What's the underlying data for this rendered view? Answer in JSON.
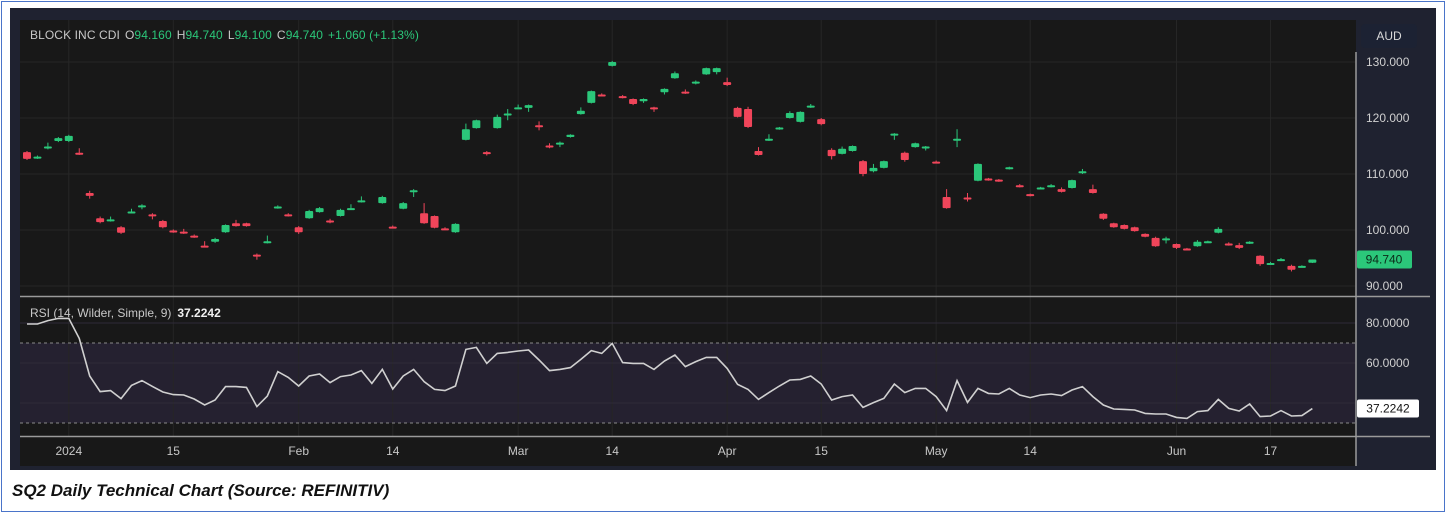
{
  "header": {
    "symbol": "BLOCK INC CDI",
    "open_label": "O",
    "open": "94.160",
    "high_label": "H",
    "high": "94.740",
    "low_label": "L",
    "low": "94.100",
    "close_label": "C",
    "close": "94.740",
    "change": "+1.060 (+1.13%)"
  },
  "currency_button": "AUD",
  "rsi_legend": {
    "label": "RSI (14, Wilder, Simple, 9)",
    "value": "37.2242"
  },
  "caption": "SQ2 Daily Technical Chart (Source: REFINITIV)",
  "colors": {
    "up": "#2bc77a",
    "down": "#f0455a",
    "rsi_line": "#d0d0d0",
    "background": "#181818",
    "rsi_band": "#252130"
  },
  "chart_data": [
    {
      "type": "candlestick",
      "title": "",
      "price_axis": {
        "range": [
          88,
          132
        ],
        "ticks": [
          90,
          100,
          110,
          120,
          130
        ],
        "tick_labels": [
          "90.000",
          "100.000",
          "110.000",
          "120.000",
          "130.000"
        ]
      },
      "last_price_label": "94.740",
      "x_ticks": [
        {
          "label": "2024",
          "at": 4
        },
        {
          "label": "15",
          "at": 14
        },
        {
          "label": "Feb",
          "at": 26
        },
        {
          "label": "14",
          "at": 35
        },
        {
          "label": "Mar",
          "at": 47
        },
        {
          "label": "14",
          "at": 56
        },
        {
          "label": "Apr",
          "at": 67
        },
        {
          "label": "15",
          "at": 76
        },
        {
          "label": "May",
          "at": 87
        },
        {
          "label": "14",
          "at": 96
        },
        {
          "label": "Jun",
          "at": 110
        },
        {
          "label": "17",
          "at": 119
        }
      ],
      "ohlc": [
        [
          113.9,
          114.1,
          112.5,
          112.7
        ],
        [
          112.9,
          113.3,
          112.7,
          113.1
        ],
        [
          114.6,
          115.6,
          114.4,
          114.9
        ],
        [
          115.9,
          116.6,
          115.7,
          116.4
        ],
        [
          115.9,
          117.0,
          115.7,
          116.8
        ],
        [
          113.8,
          114.6,
          113.4,
          113.6
        ],
        [
          106.6,
          107.0,
          105.6,
          106.1
        ],
        [
          102.1,
          102.4,
          101.2,
          101.4
        ],
        [
          101.7,
          102.4,
          101.5,
          101.9
        ],
        [
          100.5,
          100.7,
          99.3,
          99.5
        ],
        [
          103.1,
          103.8,
          103.0,
          103.3
        ],
        [
          104.2,
          104.6,
          103.7,
          104.4
        ],
        [
          102.8,
          103.0,
          101.9,
          102.6
        ],
        [
          101.6,
          101.8,
          100.3,
          100.5
        ],
        [
          99.9,
          100.1,
          99.5,
          99.7
        ],
        [
          99.7,
          100.2,
          99.3,
          99.5
        ],
        [
          99.0,
          99.2,
          98.6,
          98.8
        ],
        [
          97.2,
          98.0,
          97.0,
          97.0
        ],
        [
          97.9,
          98.6,
          97.7,
          98.4
        ],
        [
          99.6,
          101.0,
          99.5,
          100.9
        ],
        [
          101.2,
          101.8,
          100.6,
          100.7
        ],
        [
          101.2,
          101.3,
          100.6,
          100.7
        ],
        [
          95.6,
          95.8,
          94.7,
          95.4
        ],
        [
          97.8,
          99.0,
          97.6,
          98.0
        ],
        [
          104.0,
          104.4,
          103.8,
          104.2
        ],
        [
          102.8,
          103.0,
          102.4,
          102.6
        ],
        [
          100.5,
          100.7,
          99.3,
          99.6
        ],
        [
          102.1,
          103.6,
          102.0,
          103.4
        ],
        [
          103.2,
          104.1,
          103.1,
          103.9
        ],
        [
          101.7,
          102.0,
          101.2,
          101.5
        ],
        [
          102.5,
          103.8,
          102.4,
          103.6
        ],
        [
          103.7,
          104.6,
          103.6,
          103.9
        ],
        [
          105.1,
          106.0,
          104.9,
          105.3
        ],
        null,
        [
          104.8,
          106.1,
          104.7,
          105.9
        ],
        [
          100.6,
          100.8,
          100.3,
          100.5
        ],
        [
          103.8,
          105.0,
          103.7,
          104.8
        ],
        [
          106.9,
          107.3,
          105.9,
          107.1
        ],
        [
          103.0,
          104.8,
          101.1,
          101.2
        ],
        [
          102.5,
          102.6,
          100.3,
          100.4
        ],
        [
          100.3,
          100.5,
          100.0,
          100.1
        ],
        [
          99.6,
          101.2,
          99.5,
          101.1
        ],
        [
          116.1,
          119.0,
          116.0,
          118.0
        ],
        [
          118.2,
          119.7,
          118.1,
          119.6
        ],
        [
          113.9,
          114.1,
          113.3,
          113.7
        ],
        [
          118.2,
          120.6,
          118.1,
          120.2
        ],
        [
          120.6,
          121.6,
          119.6,
          120.8
        ],
        [
          121.7,
          122.4,
          121.6,
          121.9
        ],
        [
          121.8,
          122.4,
          121.1,
          122.3
        ],
        [
          118.7,
          119.4,
          117.8,
          118.5
        ],
        [
          115.1,
          115.5,
          114.6,
          114.9
        ],
        [
          115.4,
          115.8,
          114.8,
          115.6
        ],
        [
          116.6,
          117.1,
          116.5,
          117.0
        ],
        [
          120.7,
          121.9,
          120.6,
          121.3
        ],
        [
          122.7,
          124.9,
          122.6,
          124.8
        ],
        [
          124.2,
          124.4,
          123.9,
          124.0
        ],
        [
          129.3,
          130.2,
          129.2,
          130.0
        ],
        [
          123.9,
          124.1,
          123.5,
          123.7
        ],
        [
          123.4,
          123.5,
          122.3,
          122.5
        ],
        [
          123.0,
          123.5,
          122.7,
          123.4
        ],
        [
          121.9,
          122.0,
          121.1,
          121.7
        ],
        [
          124.6,
          125.3,
          124.2,
          125.2
        ],
        [
          127.1,
          128.3,
          127.0,
          128.0
        ],
        [
          124.7,
          125.1,
          124.3,
          124.5
        ],
        [
          126.3,
          126.7,
          126.0,
          126.5
        ],
        [
          127.8,
          129.0,
          127.7,
          128.9
        ],
        [
          128.2,
          129.0,
          127.8,
          128.9
        ],
        [
          126.4,
          127.2,
          125.7,
          125.9
        ],
        [
          121.8,
          122.0,
          120.1,
          120.2
        ],
        [
          121.6,
          122.0,
          118.2,
          118.4
        ],
        [
          114.1,
          114.8,
          113.3,
          113.4
        ],
        [
          116.0,
          117.1,
          115.9,
          116.3
        ],
        [
          118.1,
          118.4,
          117.9,
          118.3
        ],
        [
          120.0,
          121.2,
          119.9,
          120.9
        ],
        [
          119.3,
          121.2,
          119.2,
          121.1
        ],
        [
          122.0,
          122.5,
          121.8,
          122.2
        ],
        [
          119.8,
          120.0,
          118.7,
          118.9
        ],
        [
          114.3,
          114.6,
          112.6,
          113.2
        ],
        [
          113.6,
          114.9,
          113.5,
          114.5
        ],
        [
          114.1,
          115.1,
          114.0,
          115.0
        ],
        [
          112.3,
          112.5,
          109.6,
          110.0
        ],
        [
          110.5,
          111.8,
          110.3,
          111.1
        ],
        [
          111.1,
          112.4,
          111.0,
          112.3
        ],
        [
          117.0,
          117.3,
          116.1,
          117.2
        ],
        [
          113.8,
          114.0,
          112.2,
          112.5
        ],
        [
          114.8,
          115.6,
          114.7,
          115.5
        ],
        [
          114.8,
          115.0,
          114.2,
          114.9
        ],
        [
          112.2,
          112.4,
          111.9,
          112.0
        ],
        [
          105.9,
          107.3,
          103.8,
          103.9
        ],
        [
          116.1,
          118.0,
          114.8,
          116.3
        ],
        [
          105.8,
          106.6,
          105.1,
          105.6
        ],
        [
          108.8,
          111.9,
          108.7,
          111.8
        ],
        [
          109.2,
          109.3,
          108.8,
          109.0
        ],
        [
          109.0,
          109.1,
          108.6,
          108.8
        ],
        [
          111.0,
          111.3,
          110.8,
          111.2
        ],
        [
          108.0,
          108.2,
          107.6,
          107.8
        ],
        [
          106.4,
          106.5,
          106.0,
          106.2
        ],
        [
          107.4,
          107.7,
          107.3,
          107.6
        ],
        [
          107.8,
          108.2,
          107.6,
          108.0
        ],
        [
          107.3,
          107.6,
          106.7,
          106.8
        ],
        [
          107.5,
          109.0,
          107.4,
          108.9
        ],
        [
          110.3,
          110.9,
          110.0,
          110.5
        ],
        [
          107.3,
          108.1,
          106.5,
          106.6
        ],
        [
          102.9,
          103.0,
          101.8,
          102.0
        ],
        [
          101.2,
          101.3,
          100.4,
          100.5
        ],
        [
          100.9,
          101.0,
          100.1,
          100.2
        ],
        [
          100.5,
          100.6,
          99.7,
          99.8
        ],
        [
          99.3,
          99.4,
          98.7,
          98.8
        ],
        [
          98.6,
          98.8,
          97.0,
          97.1
        ],
        [
          98.3,
          98.8,
          97.6,
          98.5
        ],
        [
          97.5,
          97.6,
          96.6,
          96.8
        ],
        [
          96.7,
          96.8,
          96.5,
          96.6
        ],
        [
          97.1,
          98.2,
          97.0,
          97.9
        ],
        [
          97.8,
          98.1,
          97.7,
          98.0
        ],
        [
          99.5,
          100.5,
          99.4,
          100.2
        ],
        [
          97.6,
          97.8,
          97.2,
          97.4
        ],
        [
          97.3,
          97.7,
          96.6,
          96.8
        ],
        [
          97.8,
          98.0,
          97.5,
          97.9
        ],
        [
          95.4,
          95.5,
          93.6,
          93.9
        ],
        [
          94.0,
          94.3,
          93.9,
          94.1
        ],
        [
          94.7,
          95.0,
          94.5,
          94.8
        ],
        [
          93.6,
          93.8,
          92.6,
          92.9
        ],
        [
          93.5,
          93.7,
          93.4,
          93.6
        ],
        [
          94.16,
          94.74,
          94.1,
          94.74
        ]
      ]
    },
    {
      "type": "line",
      "title": "RSI (14, Wilder, Simple, 9)",
      "y_axis": {
        "range": [
          24,
          92
        ],
        "ticks": [
          80,
          60
        ],
        "tick_labels": [
          "80.0000",
          "60.0000"
        ],
        "gridlines": [
          80,
          60,
          40
        ]
      },
      "bands": {
        "upper": 70,
        "lower": 30
      },
      "last_value_label": "37.2242",
      "values": [
        79.5,
        79.5,
        81.2,
        82.3,
        82.3,
        72.3,
        53.5,
        45.7,
        46.2,
        42.2,
        48.8,
        51.2,
        48.3,
        45.5,
        44.2,
        44.0,
        42.0,
        39.0,
        41.5,
        48.2,
        48.2,
        47.8,
        38.2,
        43.5,
        55.7,
        52.8,
        48.5,
        53.5,
        54.5,
        50.2,
        53.2,
        54.0,
        56.2,
        49.8,
        56.8,
        47.0,
        53.5,
        56.8,
        50.7,
        46.8,
        46.2,
        48.5,
        66.8,
        67.8,
        59.8,
        64.8,
        65.3,
        66.0,
        66.5,
        61.5,
        56.2,
        56.8,
        57.7,
        61.8,
        66.2,
        64.8,
        69.8,
        60.2,
        59.8,
        59.8,
        56.8,
        61.0,
        64.0,
        58.2,
        60.7,
        62.8,
        62.8,
        57.3,
        49.3,
        46.8,
        41.8,
        45.2,
        48.5,
        51.5,
        51.8,
        53.5,
        49.5,
        41.5,
        43.2,
        44.0,
        37.8,
        40.2,
        42.3,
        49.5,
        45.2,
        47.3,
        47.3,
        43.2,
        36.2,
        51.2,
        40.3,
        47.3,
        44.8,
        44.5,
        47.3,
        44.0,
        42.7,
        44.0,
        44.5,
        43.7,
        46.5,
        48.2,
        43.2,
        39.0,
        37.0,
        36.8,
        36.5,
        34.8,
        34.5,
        34.5,
        32.8,
        32.3,
        35.7,
        36.2,
        41.8,
        37.3,
        36.0,
        39.5,
        33.2,
        33.5,
        36.2,
        33.5,
        33.7,
        37.2242
      ]
    }
  ]
}
